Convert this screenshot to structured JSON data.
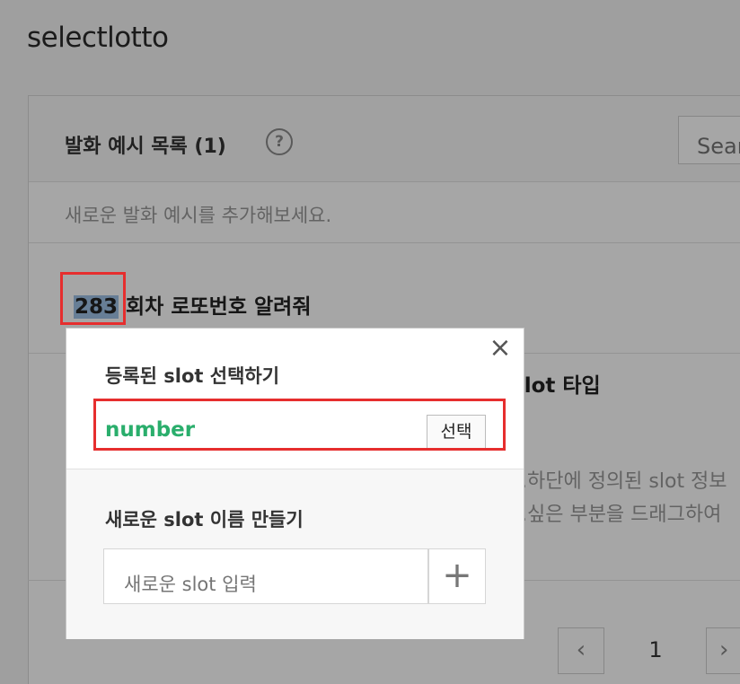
{
  "app": {
    "title": "selectlotto"
  },
  "section": {
    "title": "발화 예시 목록 (1)",
    "help_icon": "question-icon",
    "search_placeholder": "Search"
  },
  "hint": "새로운 발화 예시를 추가해보세요.",
  "utterance": {
    "slot_text": "283",
    "rest_text": " 회차 로또번호 알려줘"
  },
  "background": {
    "slot_type_text": "slot 타입",
    "guide_line_1": "...하단에 정의된 slot 정보",
    "guide_line_2": "...싶은 부분을 드래그하여"
  },
  "pager": {
    "prev_icon": "chevron-left-icon",
    "current": "1",
    "next_icon": "chevron-right-icon"
  },
  "popup": {
    "close_icon": "close-icon",
    "registered_title": "등록된 slot 선택하기",
    "slot_option": "number",
    "select_label": "선택",
    "new_title": "새로운 slot 이름 만들기",
    "new_placeholder": "새로운 slot 입력",
    "add_icon": "plus-icon"
  },
  "colors": {
    "slot_name": "#2aae6c",
    "highlight": "#e62e2e",
    "slot_selection": "#9ec2e6"
  }
}
